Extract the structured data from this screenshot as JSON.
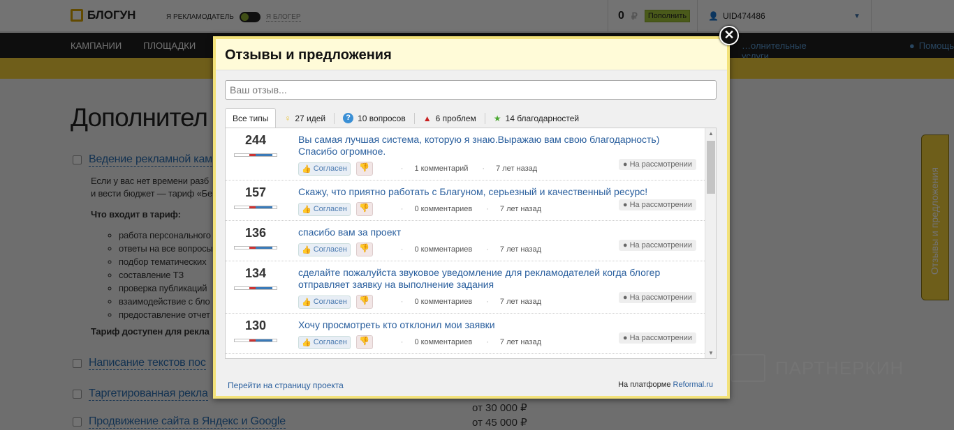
{
  "header": {
    "logo": "БЛОГУН",
    "role_advertiser": "Я РЕКЛАМОДАТЕЛЬ",
    "role_blogger": "Я БЛОГЕР",
    "balance": "0",
    "currency": "₽",
    "topup": "Пополнить",
    "user": "UID474486"
  },
  "nav": {
    "items": [
      "КАМПАНИИ",
      "ПЛОЩАДКИ"
    ],
    "extra": "…олнительные услуги",
    "help": "Помощь"
  },
  "page": {
    "title": "Дополнител",
    "services": [
      {
        "label": "Ведение рекламной кам"
      },
      {
        "label": "Написание текстов пос"
      },
      {
        "label": "Таргетированная рекла"
      },
      {
        "label": "Продвижение сайта в Яндекс и Google"
      }
    ],
    "desc1": "Если у вас нет времени разб",
    "desc2": "и вести бюджет — тариф «Бе",
    "includes": "Что входит в тариф:",
    "bullets": [
      "работа персонального",
      "ответы на все вопросы",
      "подбор тематических",
      "составление ТЗ",
      "проверка публикаций",
      "взаимодействие с бло",
      "предоставление отчет"
    ],
    "available": "Тариф доступен для рекла",
    "price_last": "от 45 000 ₽",
    "price_hidden": "от 30 000 ₽"
  },
  "side_tab": "Отзывы и предложения",
  "watermark": "ПАРТНЕРКИН",
  "modal": {
    "title": "Отзывы и предложения",
    "placeholder": "Ваш отзыв...",
    "tabs": [
      {
        "label": "Все типы",
        "icon": ""
      },
      {
        "label": "27 идей",
        "icon": "💡"
      },
      {
        "label": "10 вопросов",
        "icon": "?"
      },
      {
        "label": "6 проблем",
        "icon": "▲"
      },
      {
        "label": "14 благодарностей",
        "icon": "☆"
      }
    ],
    "agree": "Согласен",
    "items": [
      {
        "score": "244",
        "title": "Вы самая лучшая система, которую я знаю.Выражаю вам свою благодарность) Спасибо огромное.",
        "comments": "1 комментарий",
        "time": "7 лет назад",
        "status": "На рассмотрении"
      },
      {
        "score": "157",
        "title": "Скажу, что приятно работать с Благуном, серьезный и качественный ресурс!",
        "comments": "0 комментариев",
        "time": "7 лет назад",
        "status": "На рассмотрении"
      },
      {
        "score": "136",
        "title": "спасибо вам за проект",
        "comments": "0 комментариев",
        "time": "7 лет назад",
        "status": "На рассмотрении"
      },
      {
        "score": "134",
        "title": "сделайте пожалуйста звуковое уведомление для рекламодателей когда блогер отправляет заявку на выполнение задания",
        "comments": "0 комментариев",
        "time": "7 лет назад",
        "status": "На рассмотрении"
      },
      {
        "score": "130",
        "title": "Хочу просмотреть кто отклонил мои заявки",
        "comments": "0 комментариев",
        "time": "7 лет назад",
        "status": "На рассмотрении"
      }
    ],
    "footer_link": "Перейти на страницу проекта",
    "platform": "На платформе",
    "platform_link": "Reformal.ru"
  }
}
